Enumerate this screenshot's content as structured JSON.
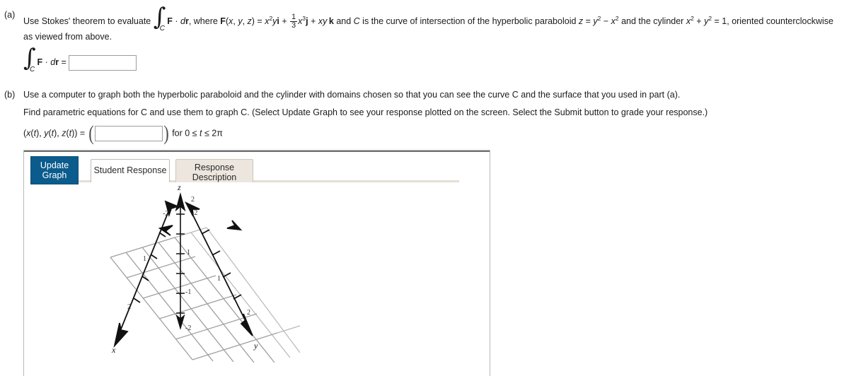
{
  "problem": {
    "part_a": {
      "label": "(a)",
      "text_before_integral": "Use Stokes' theorem to evaluate",
      "integral_sub": "C",
      "integrand": "F · dr",
      "text_where": ", where",
      "field_def_lhs": "F(x, y, z) =",
      "term1": "x²y i",
      "plus1": "+",
      "frac_num": "1",
      "frac_den": "3",
      "term2": "x³ j",
      "plus2": "+",
      "term3": "xy k",
      "text_after": "and C is the curve of intersection of the hyperbolic paraboloid z = y² − x² and the cylinder x² + y² = 1, oriented counterclockwise",
      "line2": "as viewed from above.",
      "answer_prompt_integral_sub": "C",
      "answer_prompt_integrand": "F · dr",
      "equals": "=",
      "answer_value": "",
      "answer_placeholder": ""
    },
    "part_b": {
      "label": "(b)",
      "line1": "Use a computer to graph both the hyperbolic paraboloid and the cylinder with domains chosen so that you can see the curve C and the surface that you used in part (a).",
      "line2": "Find parametric equations for C and use them to graph C. (Select Update Graph to see your response plotted on the screen. Select the Submit button to grade your response.)",
      "param_lhs": "(x(t), y(t), z(t))  =",
      "param_value": "",
      "param_placeholder": "",
      "param_range": "for 0 ≤ t ≤ 2π"
    }
  },
  "applet": {
    "update_button": "Update Graph",
    "update_button_line1": "Update",
    "update_button_line2": "Graph",
    "tabs": [
      {
        "label": "Student Response",
        "active": true
      },
      {
        "label_line1": "Response",
        "label_line2": "Description",
        "label": "Response Description",
        "active": false
      }
    ],
    "accent_color": "#0b5c8c",
    "inactive_tab_color": "#ece6de",
    "underline_color": "#e6ded4"
  },
  "chart_data": {
    "type": "scatter",
    "title": "",
    "description": "Empty 3D coordinate axes with a gray square grid drawn in the xy-plane, viewed from above and to the side.",
    "axes": [
      {
        "name": "x",
        "label": "x",
        "direction": "lower-left",
        "tick_labels": [
          "2",
          "-2"
        ],
        "range": [
          -2,
          2
        ]
      },
      {
        "name": "y",
        "label": "y",
        "direction": "lower-right",
        "tick_labels": [
          "2",
          "-2"
        ],
        "range": [
          -2,
          2
        ]
      },
      {
        "name": "z",
        "label": "z",
        "direction": "up",
        "tick_labels": [
          "2",
          "1",
          "-1",
          "-2"
        ],
        "range": [
          -2,
          2
        ]
      }
    ],
    "grid": true,
    "grid_color": "#8f8f8f",
    "axis_color": "#111111",
    "series": [],
    "legend": "none",
    "xlabel": "x",
    "ylabel": "y",
    "zlabel": "z"
  }
}
